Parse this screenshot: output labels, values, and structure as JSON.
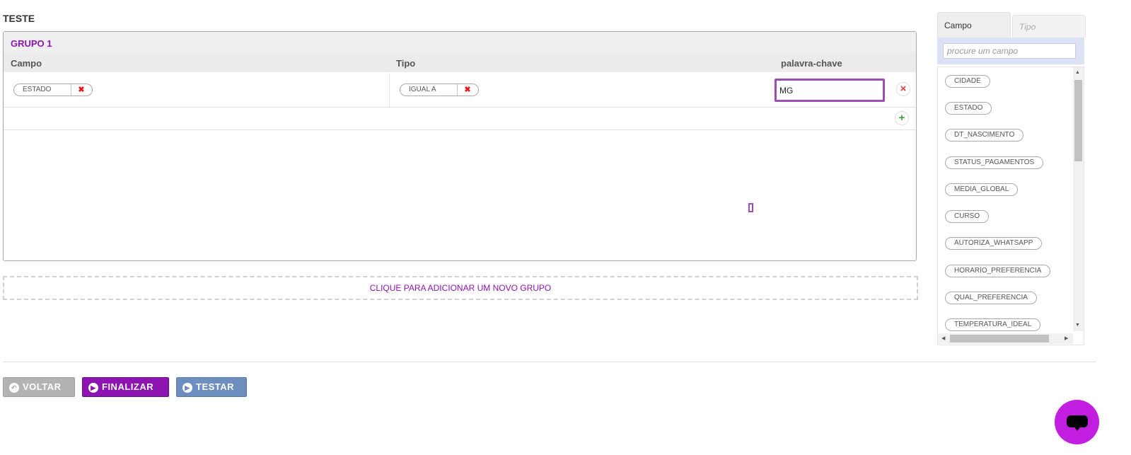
{
  "page": {
    "title": "TESTE"
  },
  "group": {
    "title": "GRUPO 1",
    "columns": {
      "campo": "Campo",
      "tipo": "Tipo",
      "keyword": "palavra-chave"
    },
    "row": {
      "field_value": "ESTADO",
      "type_value": "IGUAL A",
      "keyword_value": "MG"
    }
  },
  "add_group": {
    "label": "CLIQUE PARA ADICIONAR UM NOVO GRUPO"
  },
  "buttons": {
    "back": "VOLTAR",
    "finish": "FINALIZAR",
    "test": "TESTAR"
  },
  "side_panel": {
    "tabs": [
      "Campo",
      "Tipo"
    ],
    "search_placeholder": "procure um campo",
    "fields": [
      "CIDADE",
      "ESTADO",
      "DT_NASCIMENTO",
      "STATUS_PAGAMENTOS",
      "MEDIA_GLOBAL",
      "CURSO",
      "AUTORIZA_WHATSAPP",
      "HORARIO_PREFERENCIA",
      "QUAL_PREFERENCIA",
      "TEMPERATURA_IDEAL"
    ]
  },
  "icons": {
    "remove": "close-icon",
    "add": "plus-icon",
    "back": "back-arrow-icon",
    "play": "play-icon",
    "chat": "chat-icon"
  },
  "colors": {
    "accent": "#8e14b1",
    "test_button": "#6d8fbf",
    "back_button": "#b3b3b3",
    "chat": "#c11ee0"
  }
}
